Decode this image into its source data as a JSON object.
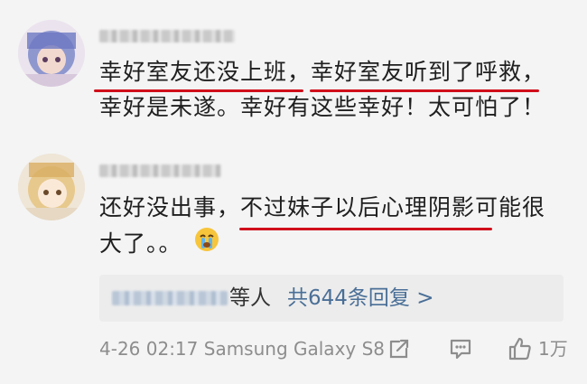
{
  "comments": [
    {
      "username": "████████",
      "lines": [
        "幸好室友还没上班，幸好室友听到了呼救，",
        "幸好是未遂。幸好有这些幸好！太可怕了！"
      ]
    },
    {
      "username": "████████",
      "lines": [
        "还好没出事，不过妹子以后心理阴影可能很",
        "大了。。"
      ]
    }
  ],
  "replies": {
    "suffix": "等人",
    "link": "共644条回复 >"
  },
  "footer": {
    "timestamp": "4-26 02:17 Samsung Galaxy S8",
    "likes": "1万"
  },
  "icons": [
    "share-icon",
    "comment-icon",
    "like-icon",
    "crying-emoji-icon"
  ],
  "colors": {
    "underline": "#d00f1b",
    "link": "#4a6f97",
    "meta": "#8d8d8d"
  }
}
